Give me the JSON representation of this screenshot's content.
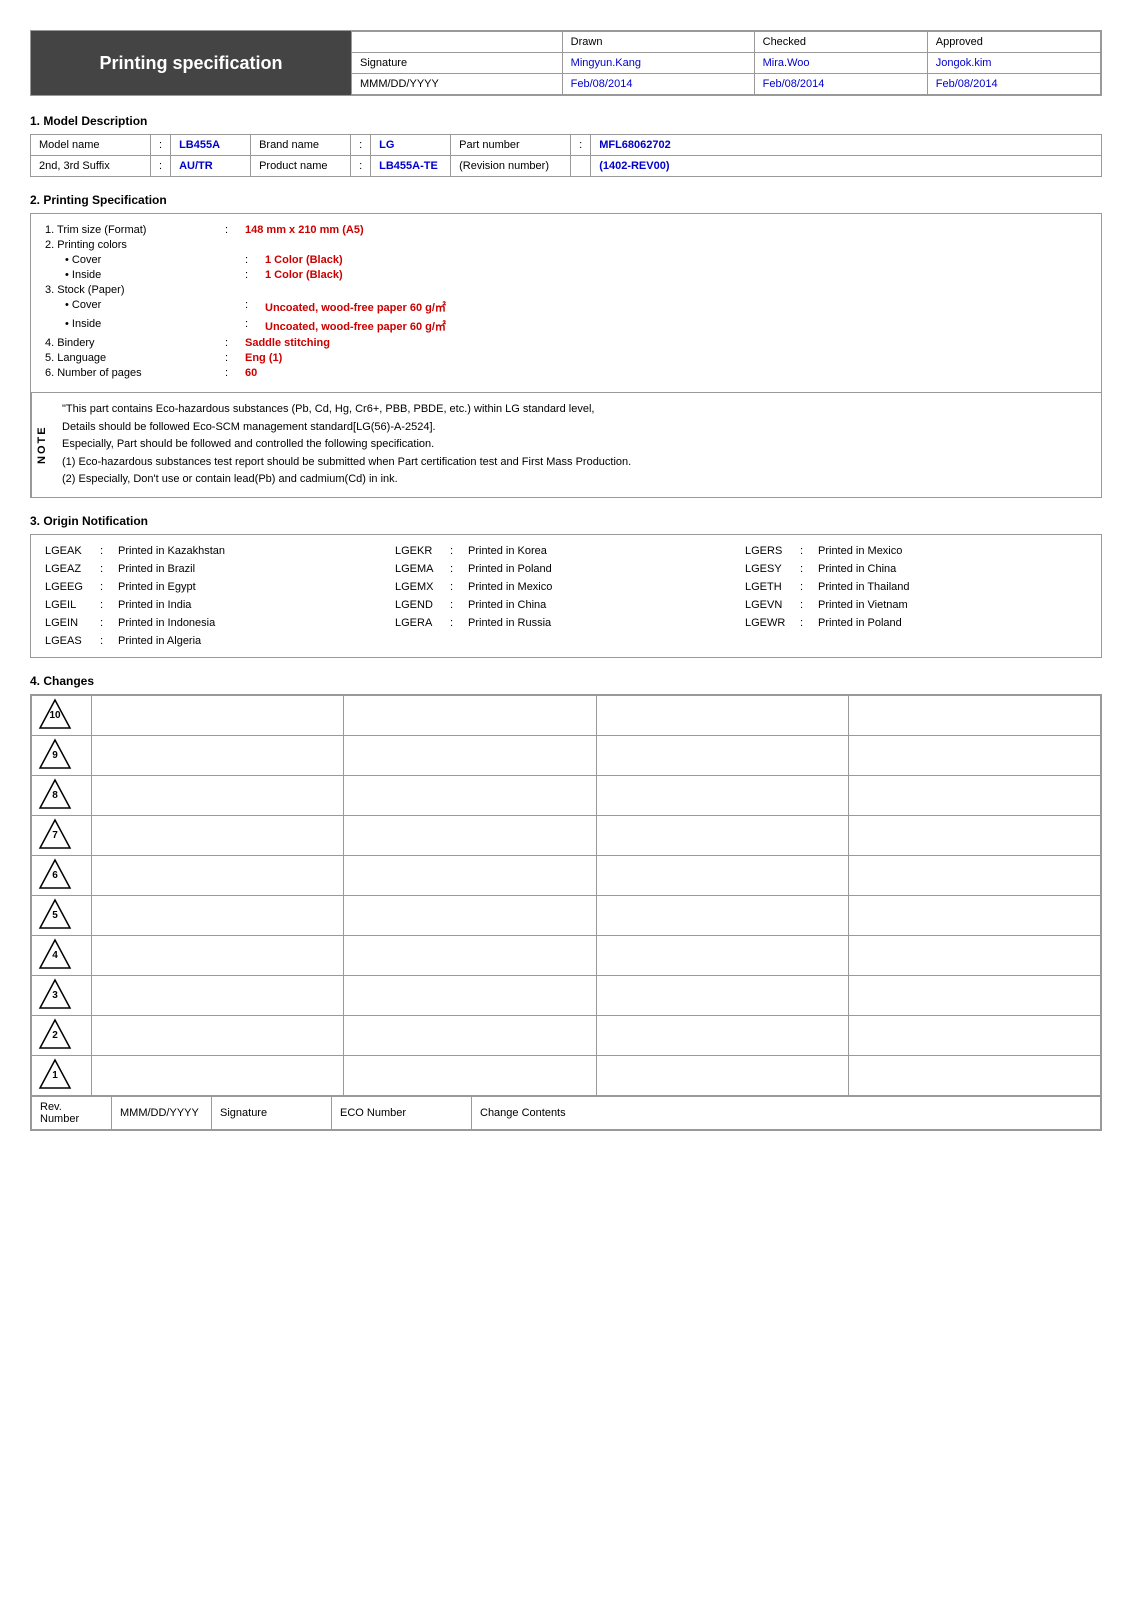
{
  "header": {
    "title": "Printing specification",
    "table": {
      "columns": [
        "",
        "Drawn",
        "Checked",
        "Approved"
      ],
      "rows": [
        [
          "Signature",
          "Mingyun.Kang",
          "Mira.Woo",
          "Jongok.kim"
        ],
        [
          "MMM/DD/YYYY",
          "Feb/08/2014",
          "Feb/08/2014",
          "Feb/08/2014"
        ]
      ]
    }
  },
  "section1": {
    "heading": "1. Model Description",
    "rows": [
      {
        "label": "Model name",
        "colon": ":",
        "value": "LB455A",
        "label2": "Brand name",
        "colon2": ":",
        "value2": "LG",
        "label3": "Part number",
        "colon3": ":",
        "value3": "MFL68062702"
      },
      {
        "label": "2nd, 3rd Suffix",
        "colon": ":",
        "value": "AU/TR",
        "label2": "Product name",
        "colon2": ":",
        "value2": "LB455A-TE",
        "label3": "(Revision number)",
        "colon3": "",
        "value3": "(1402-REV00)"
      }
    ]
  },
  "section2": {
    "heading": "2. Printing Specification",
    "items": [
      {
        "num": "1.",
        "label": "Trim size (Format)",
        "colon": ":",
        "value": "148 mm x 210 mm (A5)"
      },
      {
        "num": "2.",
        "label": "Printing colors",
        "colon": "",
        "value": ""
      },
      {
        "num": "",
        "label": "• Cover",
        "colon": ":",
        "value": "1 Color (Black)",
        "indent": true
      },
      {
        "num": "",
        "label": "• Inside",
        "colon": ":",
        "value": "1 Color (Black)",
        "indent": true
      },
      {
        "num": "3.",
        "label": "Stock (Paper)",
        "colon": "",
        "value": ""
      },
      {
        "num": "",
        "label": "• Cover",
        "colon": ":",
        "value": "Uncoated, wood-free paper 60 g/㎡",
        "indent": true
      },
      {
        "num": "",
        "label": "• Inside",
        "colon": ":",
        "value": "Uncoated, wood-free paper 60 g/㎡",
        "indent": true
      },
      {
        "num": "4.",
        "label": "Bindery",
        "colon": ":",
        "value": "Saddle stitching"
      },
      {
        "num": "5.",
        "label": "Language",
        "colon": ":",
        "value": "Eng (1)"
      },
      {
        "num": "6.",
        "label": "Number of pages",
        "colon": ":",
        "value": "60"
      }
    ]
  },
  "notes": {
    "label": "NOTE",
    "lines": [
      "\"This part contains Eco-hazardous substances (Pb, Cd, Hg, Cr6+, PBB, PBDE, etc.) within LG standard level,",
      "Details should be followed Eco-SCM management standard[LG(56)-A-2524].",
      "Especially, Part should be followed and controlled the following specification.",
      "(1) Eco-hazardous substances test report should be submitted when Part certification test and First Mass Production.",
      "(2) Especially, Don't use or contain lead(Pb) and cadmium(Cd) in ink."
    ]
  },
  "section3": {
    "heading": "3. Origin Notification",
    "items": [
      {
        "code": "LGEAK",
        "colon": ":",
        "desc": "Printed in Kazakhstan",
        "code2": "LGEKR",
        "colon2": ":",
        "desc2": "Printed in Korea",
        "code3": "LGERS",
        "colon3": ":",
        "desc3": "Printed in Mexico"
      },
      {
        "code": "LGEAZ",
        "colon": ":",
        "desc": "Printed in Brazil",
        "code2": "LGEMA",
        "colon2": ":",
        "desc2": "Printed in Poland",
        "code3": "LGESY",
        "colon3": ":",
        "desc3": "Printed in China"
      },
      {
        "code": "LGEEG",
        "colon": ":",
        "desc": "Printed in Egypt",
        "code2": "LGEMX",
        "colon2": ":",
        "desc2": "Printed in Mexico",
        "code3": "LGETH",
        "colon3": ":",
        "desc3": "Printed in Thailand"
      },
      {
        "code": "LGEIL",
        "colon": ":",
        "desc": "Printed in India",
        "code2": "LGEND",
        "colon2": ":",
        "desc2": "Printed in China",
        "code3": "LGEVN",
        "colon3": ":",
        "desc3": "Printed in Vietnam"
      },
      {
        "code": "LGEIN",
        "colon": ":",
        "desc": "Printed in Indonesia",
        "code2": "LGERA",
        "colon2": ":",
        "desc2": "Printed in Russia",
        "code3": "LGEWR",
        "colon3": ":",
        "desc3": "Printed in Poland"
      },
      {
        "code": "LGEAS",
        "colon": ":",
        "desc": "Printed in Algeria",
        "code2": "",
        "colon2": "",
        "desc2": "",
        "code3": "",
        "colon3": "",
        "desc3": ""
      }
    ]
  },
  "section4": {
    "heading": "4. Changes",
    "revisions": [
      10,
      9,
      8,
      7,
      6,
      5,
      4,
      3,
      2,
      1
    ],
    "footer": [
      "Rev. Number",
      "MMM/DD/YYYY",
      "Signature",
      "ECO Number",
      "Change Contents"
    ]
  }
}
